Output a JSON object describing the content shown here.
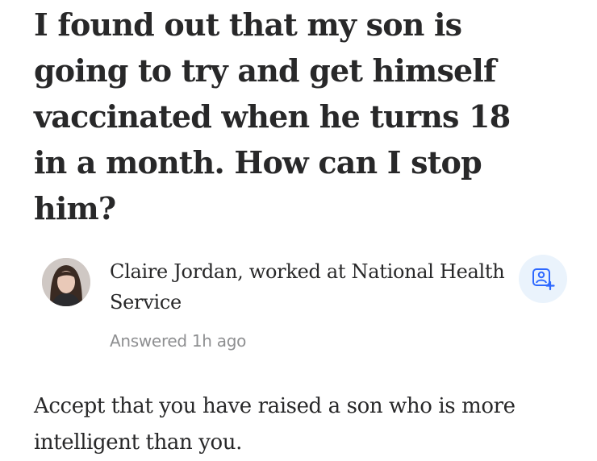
{
  "question": {
    "title": "I found out that my son is going to try and get himself vaccinated when he turns 18 in a month. How can I stop him?"
  },
  "answer": {
    "author": "Claire Jordan, worked at National Health Service",
    "timestamp": "Answered 1h ago",
    "text": "Accept that you have raised a son who is more intelligent than you."
  },
  "icons": {
    "follow": "add-person-icon"
  },
  "colors": {
    "text": "#282829",
    "meta": "#8e8f91",
    "follow_bg": "#eaf3fc",
    "follow_icon": "#2e69ff"
  }
}
